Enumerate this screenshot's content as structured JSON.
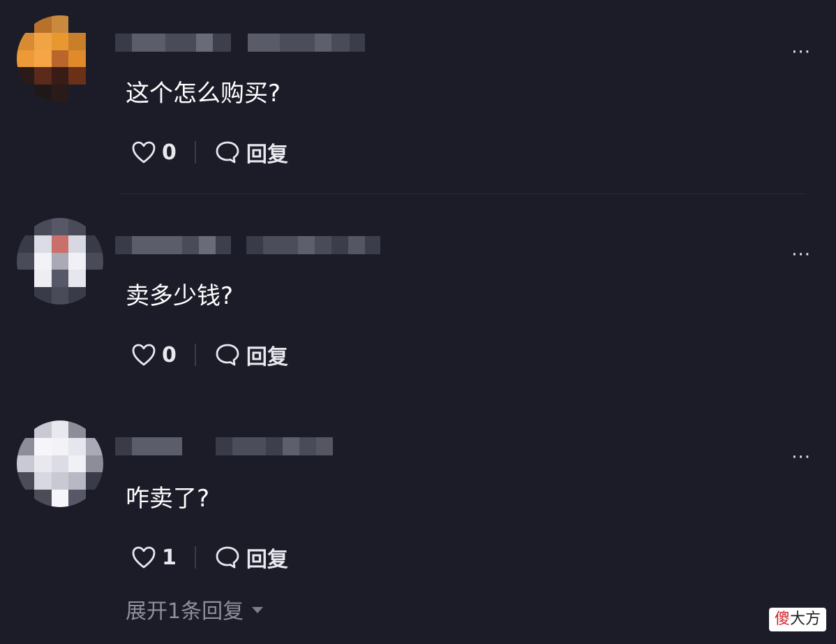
{
  "comments": [
    {
      "text": "这个怎么购买?",
      "likes": "0",
      "reply_label": "回复",
      "more_label": "···",
      "avatar_palette": [
        "#c97a2a",
        "#f0a040",
        "#e58e2a",
        "#d47a22",
        "#8a3d14"
      ]
    },
    {
      "text": "卖多少钱?",
      "likes": "0",
      "reply_label": "回复",
      "more_label": "···",
      "avatar_palette": [
        "#dcdce6",
        "#f0f0f5",
        "#a9aab6",
        "#565867",
        "#c9706a"
      ]
    },
    {
      "text": "咋卖了?",
      "likes": "1",
      "reply_label": "回复",
      "more_label": "···",
      "avatar_palette": [
        "#e8e8ee",
        "#f6f6fa",
        "#c9c9d3",
        "#8c8d99",
        "#4b4c58"
      ]
    }
  ],
  "expand_replies_label": "展开1条回复",
  "watermark": {
    "part1": "傻",
    "part2": "大方"
  },
  "colors": {
    "background": "#1b1c28",
    "text": "#ffffff",
    "muted": "#8f909c"
  }
}
